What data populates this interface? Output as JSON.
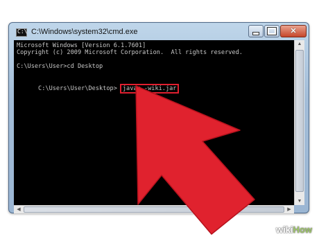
{
  "window": {
    "title": "C:\\Windows\\system32\\cmd.exe",
    "icon_text": "C:\\"
  },
  "console": {
    "lines": [
      "Microsoft Windows [Version 6.1.7601]",
      "Copyright (c) 2009 Microsoft Corporation.  All rights reserved.",
      "",
      "C:\\Users\\User>cd Desktop",
      ""
    ],
    "prompt": "C:\\Users\\User\\Desktop>",
    "highlighted_command": "javac -wiki.jar"
  },
  "annotation": {
    "highlight_color": "#e01f2f",
    "arrow_color": "#e0222e"
  },
  "watermark": {
    "prefix": "wiki",
    "suffix": "How"
  }
}
